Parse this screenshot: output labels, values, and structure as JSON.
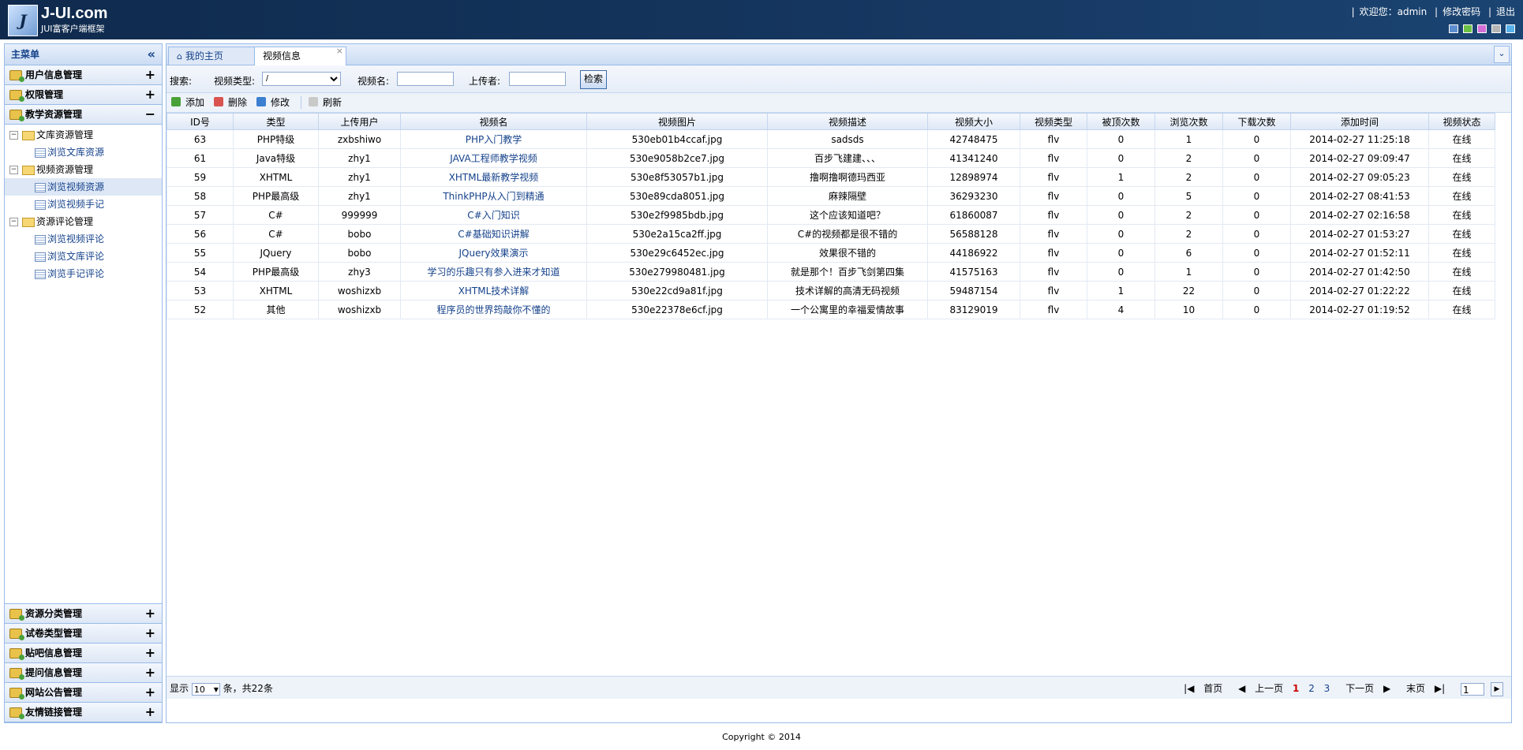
{
  "header": {
    "logo_mark": "JUI",
    "logo_title": "J-UI.com",
    "logo_sub": "JUI富客户端框架",
    "welcome": "欢迎您：admin",
    "change_password": "修改密码",
    "logout": "退出",
    "theme_colors": [
      "#5d8fd0",
      "#6ac145",
      "#d36dd8",
      "#b6b6b6",
      "#58b1e8"
    ]
  },
  "sidebar": {
    "title": "主菜单",
    "top_groups": [
      {
        "label": "用户信息管理",
        "toggle": "+"
      },
      {
        "label": "权限管理",
        "toggle": "+"
      },
      {
        "label": "教学资源管理",
        "toggle": "−"
      }
    ],
    "tree": [
      {
        "label": "文库资源管理",
        "type": "folder"
      },
      {
        "label": "浏览文库资源",
        "type": "leaf"
      },
      {
        "label": "视频资源管理",
        "type": "folder"
      },
      {
        "label": "浏览视频资源",
        "type": "leaf",
        "selected": true
      },
      {
        "label": "浏览视频手记",
        "type": "leaf"
      },
      {
        "label": "资源评论管理",
        "type": "folder"
      },
      {
        "label": "浏览视频评论",
        "type": "leaf"
      },
      {
        "label": "浏览文库评论",
        "type": "leaf"
      },
      {
        "label": "浏览手记评论",
        "type": "leaf"
      }
    ],
    "bottom_groups": [
      {
        "label": "资源分类管理",
        "toggle": "+"
      },
      {
        "label": "试卷类型管理",
        "toggle": "+"
      },
      {
        "label": "贴吧信息管理",
        "toggle": "+"
      },
      {
        "label": "提问信息管理",
        "toggle": "+"
      },
      {
        "label": "网站公告管理",
        "toggle": "+"
      },
      {
        "label": "友情链接管理",
        "toggle": "+"
      }
    ]
  },
  "tabs": [
    {
      "label": "我的主页"
    },
    {
      "label": "视频信息",
      "active": true,
      "close": "×"
    }
  ],
  "search": {
    "title": "搜索:",
    "type_label": "视频类型:",
    "type_value": "/",
    "name_label": "视频名:",
    "name_value": "",
    "uploader_label": "上传者:",
    "uploader_value": "",
    "button": "检索"
  },
  "toolbar": {
    "add": "添加",
    "delete": "删除",
    "edit": "修改",
    "refresh": "刷新"
  },
  "table": {
    "columns": [
      "ID号",
      "类型",
      "上传用户",
      "视频名",
      "视频图片",
      "视频描述",
      "视频大小",
      "视频类型",
      "被顶次数",
      "浏览次数",
      "下载次数",
      "添加时间",
      "视频状态"
    ],
    "rows": [
      [
        "63",
        "PHP特级",
        "zxbshiwo",
        "PHP入门教学",
        "530eb01b4ccaf.jpg",
        "sadsds",
        "42748475",
        "flv",
        "0",
        "1",
        "0",
        "2014-02-27 11:25:18",
        "在线"
      ],
      [
        "61",
        "Java特级",
        "zhy1",
        "JAVA工程师教学视频",
        "530e9058b2ce7.jpg",
        "百步飞建建、、、",
        "41341240",
        "flv",
        "0",
        "2",
        "0",
        "2014-02-27 09:09:47",
        "在线"
      ],
      [
        "59",
        "XHTML",
        "zhy1",
        "XHTML最新教学视频",
        "530e8f53057b1.jpg",
        "撸啊撸啊德玛西亚",
        "12898974",
        "flv",
        "1",
        "2",
        "0",
        "2014-02-27 09:05:23",
        "在线"
      ],
      [
        "58",
        "PHP最高级",
        "zhy1",
        "ThinkPHP从入门到精通",
        "530e89cda8051.jpg",
        "麻辣隔壁",
        "36293230",
        "flv",
        "0",
        "5",
        "0",
        "2014-02-27 08:41:53",
        "在线"
      ],
      [
        "57",
        "C#",
        "999999",
        "C#入门知识",
        "530e2f9985bdb.jpg",
        "这个应该知道吧？",
        "61860087",
        "flv",
        "0",
        "2",
        "0",
        "2014-02-27 02:16:58",
        "在线"
      ],
      [
        "56",
        "C#",
        "bobo",
        "C#基础知识讲解",
        "530e2a15ca2ff.jpg",
        "C#的视频都是很不错的",
        "56588128",
        "flv",
        "0",
        "2",
        "0",
        "2014-02-27 01:53:27",
        "在线"
      ],
      [
        "55",
        "JQuery",
        "bobo",
        "JQuery效果演示",
        "530e29c6452ec.jpg",
        "效果很不错的",
        "44186922",
        "flv",
        "0",
        "6",
        "0",
        "2014-02-27 01:52:11",
        "在线"
      ],
      [
        "54",
        "PHP最高级",
        "zhy3",
        "学习的乐趣只有参入进来才知道",
        "530e279980481.jpg",
        "就是那个！百步飞剑第四集",
        "41575163",
        "flv",
        "0",
        "1",
        "0",
        "2014-02-27 01:42:50",
        "在线"
      ],
      [
        "53",
        "XHTML",
        "woshizxb",
        "XHTML技术详解",
        "530e22cd9a81f.jpg",
        "技术详解的高清无码视频",
        "59487154",
        "flv",
        "1",
        "22",
        "0",
        "2014-02-27 01:22:22",
        "在线"
      ],
      [
        "52",
        "其他",
        "woshizxb",
        "程序员的世界筠敲你不懂的",
        "530e22378e6cf.jpg",
        "一个公寓里的幸福爱情故事",
        "83129019",
        "flv",
        "4",
        "10",
        "0",
        "2014-02-27 01:19:52",
        "在线"
      ]
    ]
  },
  "panelbar": {
    "show_label": "显示",
    "page_size": "10",
    "total_text": "条，共22条",
    "first": "首页",
    "prev": "上一页",
    "pages": [
      "1",
      "2",
      "3"
    ],
    "current_page": "1",
    "next": "下一页",
    "last": "末页",
    "goto_value": "1"
  },
  "footer": "Copyright © 2014"
}
